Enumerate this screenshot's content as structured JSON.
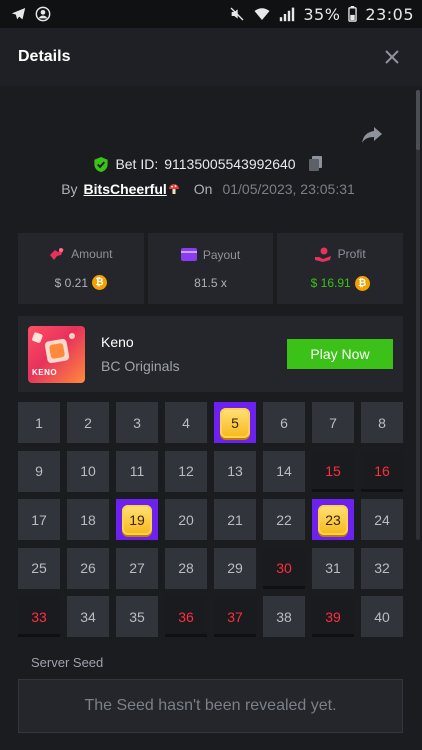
{
  "status_bar": {
    "battery": "35%",
    "time": "23:05"
  },
  "header": {
    "title": "Details"
  },
  "bet": {
    "id_label": "Bet ID:",
    "id": "91135005543992640",
    "by_label": "By",
    "username": "BitsCheerful",
    "on_label": "On",
    "date": "01/05/2023, 23:05:31"
  },
  "stats": {
    "amount": {
      "label": "Amount",
      "value": "$ 0.21"
    },
    "payout": {
      "label": "Payout",
      "value": "81.5 x"
    },
    "profit": {
      "label": "Profit",
      "value": "$ 16.91"
    }
  },
  "game": {
    "name": "Keno",
    "provider": "BC Originals",
    "thumb_label": "KENO",
    "play_label": "Play Now"
  },
  "keno": {
    "cells": [
      "1",
      "2",
      "3",
      "4",
      "5",
      "6",
      "7",
      "8",
      "9",
      "10",
      "11",
      "12",
      "13",
      "14",
      "15",
      "16",
      "17",
      "18",
      "19",
      "20",
      "21",
      "22",
      "23",
      "24",
      "25",
      "26",
      "27",
      "28",
      "29",
      "30",
      "31",
      "32",
      "33",
      "34",
      "35",
      "36",
      "37",
      "38",
      "39",
      "40"
    ],
    "hits": [
      5,
      19,
      23
    ],
    "misses": [
      15,
      16,
      30,
      33,
      36,
      37,
      39
    ]
  },
  "seed": {
    "label": "Server Seed",
    "message": "The Seed hasn't been revealed yet."
  },
  "colors": {
    "background": "#1b1c20",
    "card": "#24262b",
    "accent_green": "#3bc117",
    "hit_purple": "#6c21f0",
    "miss_red": "#ff2e3d",
    "coin": "#f2a100"
  }
}
